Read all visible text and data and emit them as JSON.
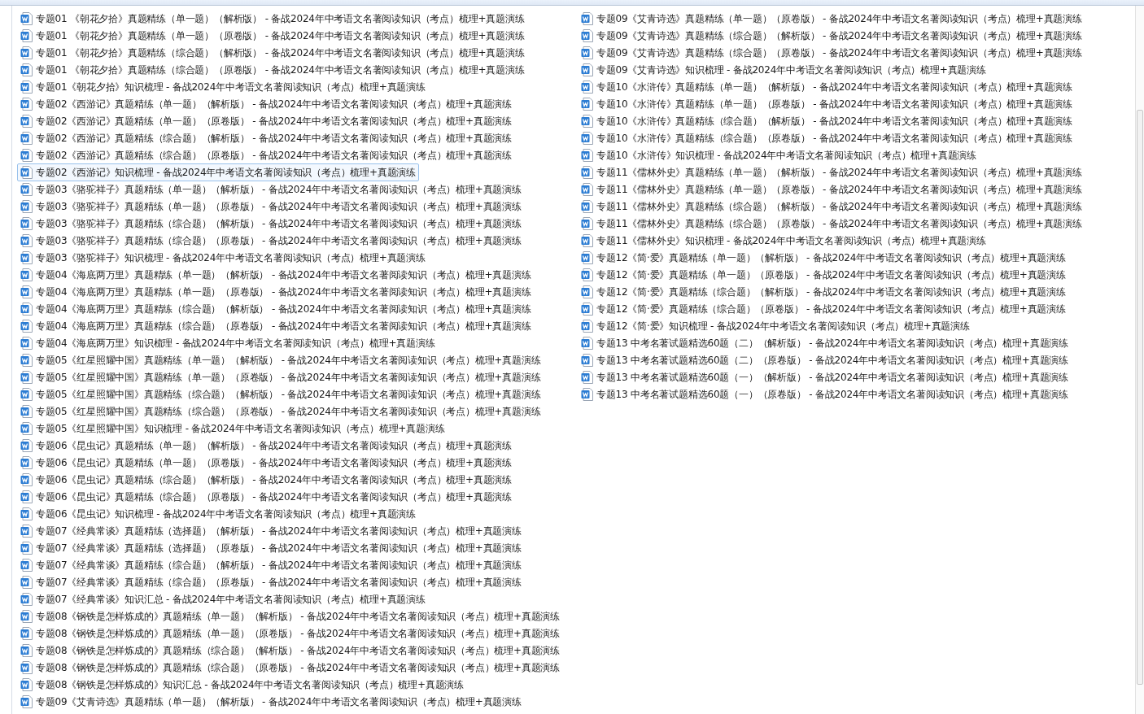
{
  "files": [
    {
      "name": "专题01 《朝花夕拾》真题精练（单一题）（解析版） - 备战2024年中考语文名著阅读知识（考点）梳理+真题演练",
      "selected": false
    },
    {
      "name": "专题01 《朝花夕拾》真题精练（单一题）（原卷版） - 备战2024年中考语文名著阅读知识（考点）梳理+真题演练",
      "selected": false
    },
    {
      "name": "专题01 《朝花夕拾》真题精练（综合题）（解析版） - 备战2024年中考语文名著阅读知识（考点）梳理+真题演练",
      "selected": false
    },
    {
      "name": "专题01 《朝花夕拾》真题精练（综合题）（原卷版） - 备战2024年中考语文名著阅读知识（考点）梳理+真题演练",
      "selected": false
    },
    {
      "name": "专题01《朝花夕拾》知识梳理 - 备战2024年中考语文名著阅读知识（考点）梳理+真题演练",
      "selected": false
    },
    {
      "name": "专题02《西游记》真题精练（单一题）（解析版） - 备战2024年中考语文名著阅读知识（考点）梳理+真题演练",
      "selected": false
    },
    {
      "name": "专题02《西游记》真题精练（单一题）（原卷版） - 备战2024年中考语文名著阅读知识（考点）梳理+真题演练",
      "selected": false
    },
    {
      "name": "专题02《西游记》真题精练（综合题）（解析版） - 备战2024年中考语文名著阅读知识（考点）梳理+真题演练",
      "selected": false
    },
    {
      "name": "专题02《西游记》真题精练（综合题）（原卷版） - 备战2024年中考语文名著阅读知识（考点）梳理+真题演练",
      "selected": false
    },
    {
      "name": "专题02《西游记》知识梳理 - 备战2024年中考语文名著阅读知识（考点）梳理+真题演练",
      "selected": true
    },
    {
      "name": "专题03《骆驼祥子》真题精练（单一题）（解析版） - 备战2024年中考语文名著阅读知识（考点）梳理+真题演练",
      "selected": false
    },
    {
      "name": "专题03《骆驼祥子》真题精练（单一题）（原卷版） - 备战2024年中考语文名著阅读知识（考点）梳理+真题演练",
      "selected": false
    },
    {
      "name": "专题03《骆驼祥子》真题精练（综合题）（解析版） - 备战2024年中考语文名著阅读知识（考点）梳理+真题演练",
      "selected": false
    },
    {
      "name": "专题03《骆驼祥子》真题精练（综合题）（原卷版） - 备战2024年中考语文名著阅读知识（考点）梳理+真题演练",
      "selected": false
    },
    {
      "name": "专题03《骆驼祥子》知识梳理 - 备战2024年中考语文名著阅读知识（考点）梳理+真题演练",
      "selected": false
    },
    {
      "name": "专题04《海底两万里》真题精练（单一题）（解析版） - 备战2024年中考语文名著阅读知识（考点）梳理+真题演练",
      "selected": false
    },
    {
      "name": "专题04《海底两万里》真题精练（单一题）（原卷版） - 备战2024年中考语文名著阅读知识（考点）梳理+真题演练",
      "selected": false
    },
    {
      "name": "专题04《海底两万里》真题精练（综合题）（解析版） - 备战2024年中考语文名著阅读知识（考点）梳理+真题演练",
      "selected": false
    },
    {
      "name": "专题04《海底两万里》真题精练（综合题）（原卷版） - 备战2024年中考语文名著阅读知识（考点）梳理+真题演练",
      "selected": false
    },
    {
      "name": "专题04《海底两万里》知识梳理 - 备战2024年中考语文名著阅读知识（考点）梳理+真题演练",
      "selected": false
    },
    {
      "name": "专题05《红星照耀中国》真题精练（单一题）（解析版） - 备战2024年中考语文名著阅读知识（考点）梳理+真题演练",
      "selected": false
    },
    {
      "name": "专题05《红星照耀中国》真题精练（单一题）（原卷版） - 备战2024年中考语文名著阅读知识（考点）梳理+真题演练",
      "selected": false
    },
    {
      "name": "专题05《红星照耀中国》真题精练（综合题）（解析版） - 备战2024年中考语文名著阅读知识（考点）梳理+真题演练",
      "selected": false
    },
    {
      "name": "专题05《红星照耀中国》真题精练（综合题）（原卷版） - 备战2024年中考语文名著阅读知识（考点）梳理+真题演练",
      "selected": false
    },
    {
      "name": "专题05《红星照耀中国》知识梳理 - 备战2024年中考语文名著阅读知识（考点）梳理+真题演练",
      "selected": false
    },
    {
      "name": "专题06《昆虫记》真题精练（单一题）（解析版） - 备战2024年中考语文名著阅读知识（考点）梳理+真题演练",
      "selected": false
    },
    {
      "name": "专题06《昆虫记》真题精练（单一题）（原卷版） - 备战2024年中考语文名著阅读知识（考点）梳理+真题演练",
      "selected": false
    },
    {
      "name": "专题06《昆虫记》真题精练（综合题）（解析版） - 备战2024年中考语文名著阅读知识（考点）梳理+真题演练",
      "selected": false
    },
    {
      "name": "专题06《昆虫记》真题精练（综合题）（原卷版） - 备战2024年中考语文名著阅读知识（考点）梳理+真题演练",
      "selected": false
    },
    {
      "name": "专题06《昆虫记》知识梳理 - 备战2024年中考语文名著阅读知识（考点）梳理+真题演练",
      "selected": false
    },
    {
      "name": "专题07《经典常谈》真题精练（选择题）（解析版） - 备战2024年中考语文名著阅读知识（考点）梳理+真题演练",
      "selected": false
    },
    {
      "name": "专题07《经典常谈》真题精练（选择题）（原卷版） - 备战2024年中考语文名著阅读知识（考点）梳理+真题演练",
      "selected": false
    },
    {
      "name": "专题07《经典常谈》真题精练（综合题）（解析版） - 备战2024年中考语文名著阅读知识（考点）梳理+真题演练",
      "selected": false
    },
    {
      "name": "专题07《经典常谈》真题精练（综合题）（原卷版） - 备战2024年中考语文名著阅读知识（考点）梳理+真题演练",
      "selected": false
    },
    {
      "name": "专题07《经典常谈》知识汇总 - 备战2024年中考语文名著阅读知识（考点）梳理+真题演练",
      "selected": false
    },
    {
      "name": "专题08《钢铁是怎样炼成的》真题精练（单一题）（解析版） - 备战2024年中考语文名著阅读知识（考点）梳理+真题演练",
      "selected": false
    },
    {
      "name": "专题08《钢铁是怎样炼成的》真题精练（单一题）（原卷版） - 备战2024年中考语文名著阅读知识（考点）梳理+真题演练",
      "selected": false
    },
    {
      "name": "专题08《钢铁是怎样炼成的》真题精练（综合题）（解析版） - 备战2024年中考语文名著阅读知识（考点）梳理+真题演练",
      "selected": false
    },
    {
      "name": "专题08《钢铁是怎样炼成的》真题精练（综合题）（原卷版） - 备战2024年中考语文名著阅读知识（考点）梳理+真题演练",
      "selected": false
    },
    {
      "name": "专题08《钢铁是怎样炼成的》知识汇总 - 备战2024年中考语文名著阅读知识（考点）梳理+真题演练",
      "selected": false
    },
    {
      "name": "专题09《艾青诗选》真题精练（单一题）（解析版） - 备战2024年中考语文名著阅读知识（考点）梳理+真题演练",
      "selected": false
    },
    {
      "name": "专题09《艾青诗选》真题精练（单一题）（原卷版） - 备战2024年中考语文名著阅读知识（考点）梳理+真题演练",
      "selected": false
    },
    {
      "name": "专题09《艾青诗选》真题精练（综合题）（解析版） - 备战2024年中考语文名著阅读知识（考点）梳理+真题演练",
      "selected": false
    },
    {
      "name": "专题09《艾青诗选》真题精练（综合题）（原卷版） - 备战2024年中考语文名著阅读知识（考点）梳理+真题演练",
      "selected": false
    },
    {
      "name": "专题09《艾青诗选》知识梳理 - 备战2024年中考语文名著阅读知识（考点）梳理+真题演练",
      "selected": false
    },
    {
      "name": "专题10《水浒传》真题精练（单一题）（解析版） - 备战2024年中考语文名著阅读知识（考点）梳理+真题演练",
      "selected": false
    },
    {
      "name": "专题10《水浒传》真题精练（单一题）（原卷版） - 备战2024年中考语文名著阅读知识（考点）梳理+真题演练",
      "selected": false
    },
    {
      "name": "专题10《水浒传》真题精练（综合题）（解析版） - 备战2024年中考语文名著阅读知识（考点）梳理+真题演练",
      "selected": false
    },
    {
      "name": "专题10《水浒传》真题精练（综合题）（原卷版） - 备战2024年中考语文名著阅读知识（考点）梳理+真题演练",
      "selected": false
    },
    {
      "name": "专题10《水浒传》知识梳理 - 备战2024年中考语文名著阅读知识（考点）梳理+真题演练",
      "selected": false
    },
    {
      "name": "专题11《儒林外史》真题精练（单一题）（解析版） - 备战2024年中考语文名著阅读知识（考点）梳理+真题演练",
      "selected": false
    },
    {
      "name": "专题11《儒林外史》真题精练（单一题）（原卷版） - 备战2024年中考语文名著阅读知识（考点）梳理+真题演练",
      "selected": false
    },
    {
      "name": "专题11《儒林外史》真题精练（综合题）（解析版） - 备战2024年中考语文名著阅读知识（考点）梳理+真题演练",
      "selected": false
    },
    {
      "name": "专题11《儒林外史》真题精练（综合题）（原卷版） - 备战2024年中考语文名著阅读知识（考点）梳理+真题演练",
      "selected": false
    },
    {
      "name": "专题11《儒林外史》知识梳理 - 备战2024年中考语文名著阅读知识（考点）梳理+真题演练",
      "selected": false
    },
    {
      "name": "专题12《简·爱》真题精练（单一题）（解析版） - 备战2024年中考语文名著阅读知识（考点）梳理+真题演练",
      "selected": false
    },
    {
      "name": "专题12《简·爱》真题精练（单一题）（原卷版） - 备战2024年中考语文名著阅读知识（考点）梳理+真题演练",
      "selected": false
    },
    {
      "name": "专题12《简·爱》真题精练（综合题）（解析版） - 备战2024年中考语文名著阅读知识（考点）梳理+真题演练",
      "selected": false
    },
    {
      "name": "专题12《简·爱》真题精练（综合题）（原卷版） - 备战2024年中考语文名著阅读知识（考点）梳理+真题演练",
      "selected": false
    },
    {
      "name": "专题12《简·爱》知识梳理 - 备战2024年中考语文名著阅读知识（考点）梳理+真题演练",
      "selected": false
    },
    {
      "name": "专题13 中考名著试题精选60题（二）（解析版） - 备战2024年中考语文名著阅读知识（考点）梳理+真题演练",
      "selected": false
    },
    {
      "name": "专题13 中考名著试题精选60题（二）（原卷版） - 备战2024年中考语文名著阅读知识（考点）梳理+真题演练",
      "selected": false
    },
    {
      "name": "专题13 中考名著试题精选60题（一）（解析版） - 备战2024年中考语文名著阅读知识（考点）梳理+真题演练",
      "selected": false
    },
    {
      "name": "专题13 中考名著试题精选60题（一）（原卷版） - 备战2024年中考语文名著阅读知识（考点）梳理+真题演练",
      "selected": false
    }
  ]
}
